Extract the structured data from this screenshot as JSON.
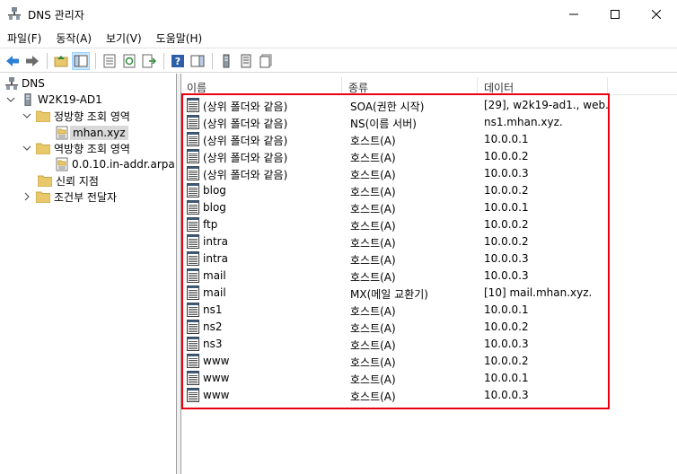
{
  "window": {
    "title": "DNS 관리자"
  },
  "menu": [
    "파일(F)",
    "동작(A)",
    "보기(V)",
    "도움말(H)"
  ],
  "tree": {
    "root": "DNS",
    "server": "W2K19-AD1",
    "forward_zones": "정방향 조회 영역",
    "forward_zone_item": "mhan.xyz",
    "reverse_zones": "역방향 조회 영역",
    "reverse_zone_item": "0.0.10.in-addr.arpa",
    "trust_points": "신뢰 지점",
    "conditional_forwarders": "조건부 전달자"
  },
  "columns": {
    "name": "이름",
    "type": "종류",
    "data": "데이터"
  },
  "records": [
    {
      "name": "(상위 폴더와 같음)",
      "type": "SOA(권한 시작)",
      "data": "[29], w2k19-ad1., web."
    },
    {
      "name": "(상위 폴더와 같음)",
      "type": "NS(이름 서버)",
      "data": "ns1.mhan.xyz."
    },
    {
      "name": "(상위 폴더와 같음)",
      "type": "호스트(A)",
      "data": "10.0.0.1"
    },
    {
      "name": "(상위 폴더와 같음)",
      "type": "호스트(A)",
      "data": "10.0.0.2"
    },
    {
      "name": "(상위 폴더와 같음)",
      "type": "호스트(A)",
      "data": "10.0.0.3"
    },
    {
      "name": "blog",
      "type": "호스트(A)",
      "data": "10.0.0.2"
    },
    {
      "name": "blog",
      "type": "호스트(A)",
      "data": "10.0.0.1"
    },
    {
      "name": "ftp",
      "type": "호스트(A)",
      "data": "10.0.0.2"
    },
    {
      "name": "intra",
      "type": "호스트(A)",
      "data": "10.0.0.2"
    },
    {
      "name": "intra",
      "type": "호스트(A)",
      "data": "10.0.0.3"
    },
    {
      "name": "mail",
      "type": "호스트(A)",
      "data": "10.0.0.3"
    },
    {
      "name": "mail",
      "type": "MX(메일 교환기)",
      "data": "[10]  mail.mhan.xyz."
    },
    {
      "name": "ns1",
      "type": "호스트(A)",
      "data": "10.0.0.1"
    },
    {
      "name": "ns2",
      "type": "호스트(A)",
      "data": "10.0.0.2"
    },
    {
      "name": "ns3",
      "type": "호스트(A)",
      "data": "10.0.0.3"
    },
    {
      "name": "www",
      "type": "호스트(A)",
      "data": "10.0.0.2"
    },
    {
      "name": "www",
      "type": "호스트(A)",
      "data": "10.0.0.1"
    },
    {
      "name": "www",
      "type": "호스트(A)",
      "data": "10.0.0.3"
    }
  ],
  "colors": {
    "highlight": "#e8000f",
    "folder": "#e8c86a",
    "selection": "#d9d9d9"
  }
}
